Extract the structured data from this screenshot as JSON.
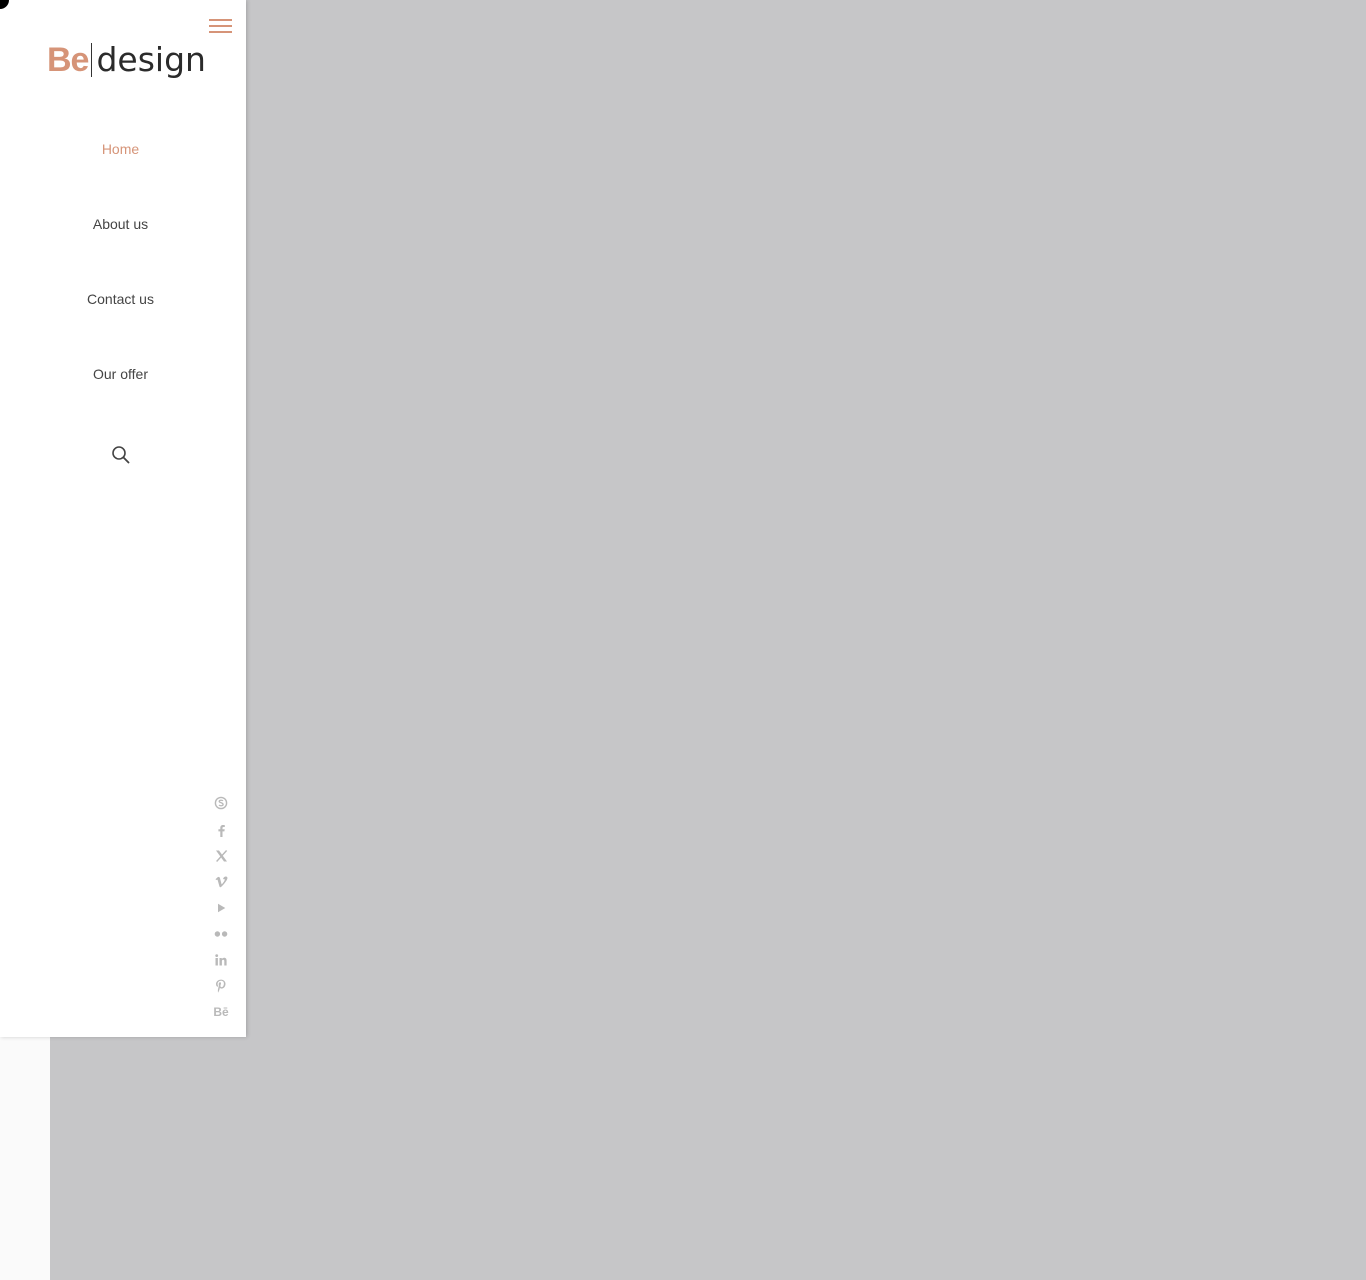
{
  "colors": {
    "accent": "#d69478",
    "text": "#444444",
    "social": "#b9b9b9",
    "overlay": "#c6c6c8"
  },
  "logo": {
    "brand_part": "Be",
    "rest": "design"
  },
  "nav": {
    "items": [
      {
        "label": "Home",
        "active": true
      },
      {
        "label": "About us",
        "active": false
      },
      {
        "label": "Contact us",
        "active": false
      },
      {
        "label": "Our offer",
        "active": false
      }
    ]
  },
  "icons": {
    "menu": "hamburger-icon",
    "search": "search-icon",
    "social": [
      "skype-icon",
      "facebook-icon",
      "x-icon",
      "vimeo-icon",
      "youtube-icon",
      "flickr-icon",
      "linkedin-icon",
      "pinterest-icon",
      "behance-icon"
    ]
  },
  "social_labels": {
    "behance": "Bē"
  }
}
